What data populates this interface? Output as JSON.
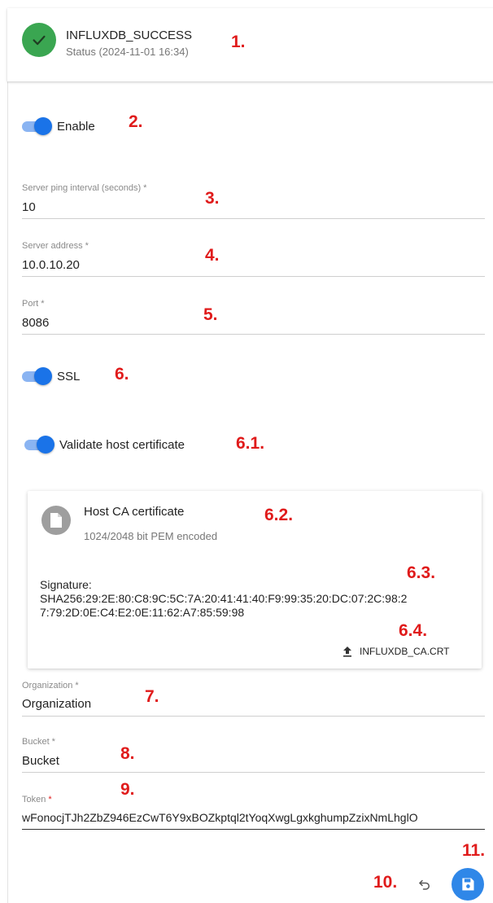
{
  "status": {
    "title": "INFLUXDB_SUCCESS",
    "subtitle": "Status (2024-11-01 16:34)",
    "icon": "check-icon",
    "color": "#3aa651"
  },
  "steps": {
    "s1": "1.",
    "s2": "2.",
    "s3": "3.",
    "s4": "4.",
    "s5": "5.",
    "s6": "6.",
    "s61": "6.1.",
    "s62": "6.2.",
    "s63": "6.3.",
    "s64": "6.4.",
    "s7": "7.",
    "s8": "8.",
    "s9": "9.",
    "s10": "10.",
    "s11": "11."
  },
  "enable": {
    "label": "Enable",
    "on": true
  },
  "ping_interval": {
    "label": "Server ping interval (seconds) *",
    "value": "10"
  },
  "server_address": {
    "label": "Server address *",
    "value": "10.0.10.20"
  },
  "port": {
    "label": "Port *",
    "value": "8086"
  },
  "ssl": {
    "label": "SSL",
    "on": true
  },
  "validate_cert": {
    "label": "Validate host certificate",
    "on": true
  },
  "certificate": {
    "title": "Host CA certificate",
    "subtitle": "1024/2048 bit PEM encoded",
    "signature_label": "Signature:",
    "signature_line1": "SHA256:29:2E:80:C8:9C:5C:7A:20:41:41:40:F9:99:35:20:DC:07:2C:98:2",
    "signature_line2": "7:79:2D:0E:C4:E2:0E:11:62:A7:85:59:98",
    "file_name": "INFLUXDB_CA.CRT"
  },
  "organization": {
    "label": "Organization *",
    "value": "Organization"
  },
  "bucket": {
    "label": "Bucket *",
    "value": "Bucket"
  },
  "token": {
    "label": "Token",
    "required_mark": "*",
    "value": "wFonocjTJh2ZbZ946EzCwT6Y9xBOZkptql2tYoqXwgLgxkghumpZzixNmLhglO"
  },
  "colors": {
    "accent": "#1a73e8",
    "step_red": "#e01b1b",
    "save": "#2f87e8"
  }
}
